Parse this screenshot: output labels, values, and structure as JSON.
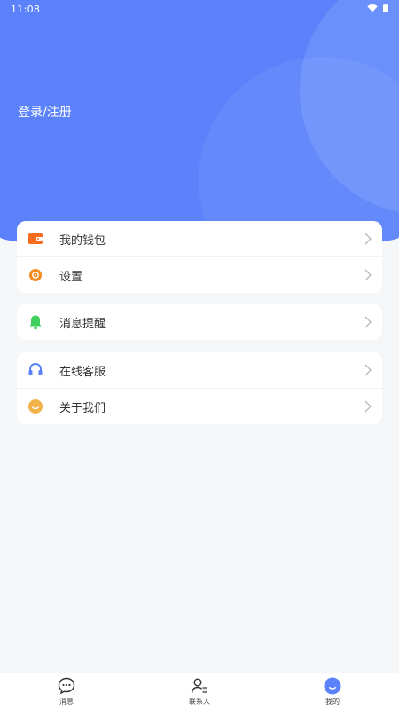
{
  "status_bar": {
    "time": "11:08",
    "icons": [
      "wifi-icon",
      "battery-icon"
    ]
  },
  "header": {
    "login_label": "登录/注册",
    "accent_color": "#5b82fa"
  },
  "menu": {
    "group1": [
      {
        "label": "我的钱包",
        "icon": "wallet-icon",
        "color": "#f76b1c"
      },
      {
        "label": "设置",
        "icon": "settings-icon",
        "color": "#f58a1f"
      }
    ],
    "group2": [
      {
        "label": "消息提醒",
        "icon": "bell-icon",
        "color": "#3ecf5d"
      }
    ],
    "group3": [
      {
        "label": "在线客服",
        "icon": "headset-icon",
        "color": "#5b82fa"
      },
      {
        "label": "关于我们",
        "icon": "smile-icon",
        "color": "#f2b24b"
      }
    ]
  },
  "tabbar": {
    "tabs": [
      {
        "label": "消息",
        "icon": "chat-bubble-icon",
        "active": false
      },
      {
        "label": "联系人",
        "icon": "contacts-icon",
        "active": false
      },
      {
        "label": "我的",
        "icon": "profile-face-icon",
        "active": true
      }
    ]
  }
}
